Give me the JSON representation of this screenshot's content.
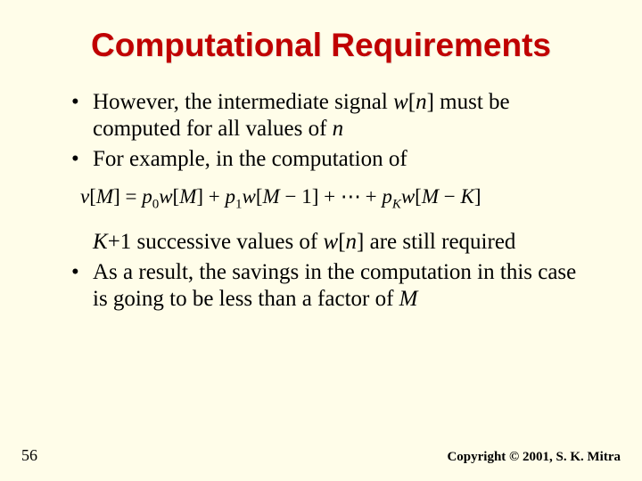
{
  "title": "Computational Requirements",
  "bullet1_pre": "However, the intermediate signal ",
  "bullet1_wn": "w",
  "bullet1_bracket_open": "[",
  "bullet1_n": "n",
  "bullet1_bracket_close": "]",
  "bullet1_post": " must be computed for all values of ",
  "bullet1_n2": "n",
  "bullet2": "For example, in the computation of",
  "equation": {
    "v": "v",
    "lb1": "[",
    "M1": "M",
    "rb1": "] = ",
    "p": "p",
    "s0": "0",
    "w1": "w",
    "lb2": "[",
    "M2": "M",
    "rb2": "] + ",
    "p2": "p",
    "s1": "1",
    "w2": "w",
    "lb3": "[",
    "M3": "M",
    "minus1": " − 1] + ",
    "ell": "⋯",
    "plus": " + ",
    "p3": "p",
    "sK": "K",
    "w3": "w",
    "lb4": "[",
    "M4": "M",
    "minusK": " − ",
    "K2": "K",
    "rb4": "]"
  },
  "bullet3_K": "K",
  "bullet3_plus1": "+1 successive values of ",
  "bullet3_w": "w",
  "bullet3_lb": "[",
  "bullet3_n": "n",
  "bullet3_rb": "]",
  "bullet3_post": " are still required",
  "bullet4_pre": "As a result, the savings in the computation in this case is going to be less than a factor of ",
  "bullet4_M": "M",
  "page_number": "56",
  "copyright": "Copyright © 2001, S. K. Mitra"
}
